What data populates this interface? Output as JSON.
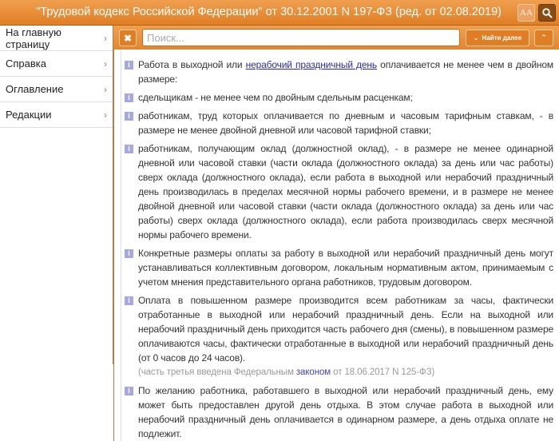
{
  "header": {
    "title": "\"Трудовой кодекс Российской Федерации\" от 30.12.2001 N 197-ФЗ (ред. от 02.08.2019)",
    "font_button": "AA"
  },
  "sidebar": {
    "items": [
      {
        "label": "На главную страницу"
      },
      {
        "label": "Справка"
      },
      {
        "label": "Оглавление"
      },
      {
        "label": "Редакции"
      }
    ],
    "chevron": "›"
  },
  "toolbar": {
    "clear": "✖",
    "search_placeholder": "Поиск...",
    "search_value": "",
    "next_label": "Найти далее",
    "next_icon": "⌄",
    "prev_icon": "⌃"
  },
  "paragraphs": [
    {
      "pre": "Работа в выходной или ",
      "link": "нерабочий праздничный день",
      "post": " оплачивается не менее чем в двойном размере:"
    },
    {
      "pre": "сдельщикам - не менее чем по двойным сдельным расценкам;"
    },
    {
      "pre": "работникам, труд которых оплачивается по дневным и часовым тарифным ставкам, - в размере не менее двойной дневной или часовой тарифной ставки;"
    },
    {
      "pre": "работникам, получающим оклад (должностной оклад), - в размере не менее одинарной дневной или часовой ставки (части оклада (должностного оклада) за день или час работы) сверх оклада (должностного оклада), если работа в выходной или нерабочий праздничный день производилась в пределах месячной нормы рабочего времени, и в размере не менее двойной дневной или часовой ставки (части оклада (должностного оклада) за день или час работы) сверх оклада (должностного оклада), если работа производилась сверх месячной нормы рабочего времени."
    },
    {
      "pre": "Конкретные размеры оплаты за работу в выходной или нерабочий праздничный день могут устанавливаться коллективным договором, локальным нормативным актом, принимаемым с учетом мнения представительного органа работников, трудовым договором."
    },
    {
      "pre": "Оплата в повышенном размере производится всем работникам за часы, фактически отработанные в выходной или нерабочий праздничный день. Если на выходной или нерабочий праздничный день приходится часть рабочего дня (смены), в повышенном размере оплачиваются часы, фактически отработанные в выходной или нерабочий праздничный день (от 0 часов до 24 часов)."
    },
    {
      "pre": "По желанию работника, работавшего в выходной или нерабочий праздничный день, ему может быть предоставлен другой день отдыха. В этом случае работа в выходной или нерабочий праздничный день оплачивается в одинарном размере, а день отдыха оплате не подлежит."
    }
  ],
  "note": {
    "pre": "(часть третья введена Федеральным ",
    "link": "законом",
    "post": " от 18.06.2017 N 125-ФЗ)"
  },
  "info_icon": "i"
}
